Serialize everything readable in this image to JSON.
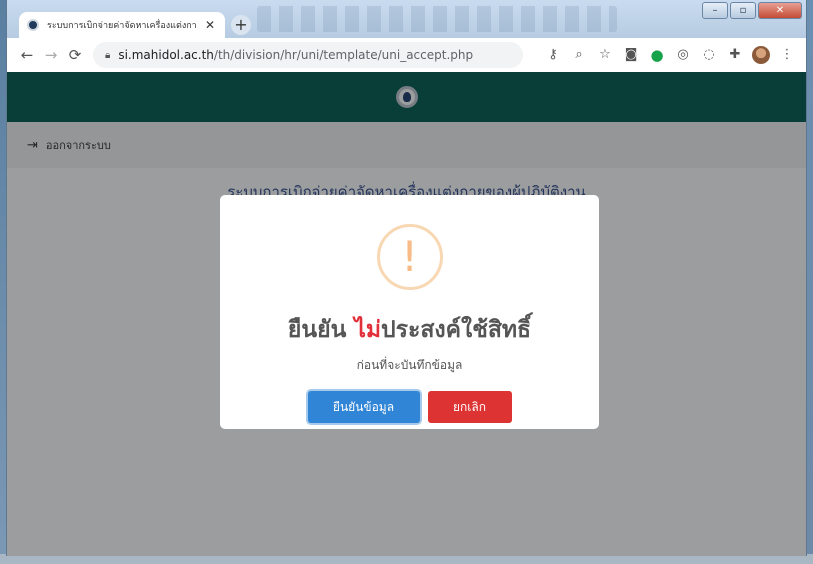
{
  "browser": {
    "tab_title": "ระบบการเบิกจ่ายค่าจัดหาเครื่องแต่งกาย",
    "tab_close": "✕",
    "new_tab": "+",
    "url_host": "si.mahidol.ac.th",
    "url_path": "/th/division/hr/uni/template/uni_accept.php",
    "window_controls": {
      "minimize": "–",
      "maximize": "▫",
      "close": "✕"
    },
    "toolbar_icons": [
      "key-icon",
      "zoom-icon",
      "star-icon",
      "camera-icon",
      "grammarly-icon",
      "extension-icon",
      "extension-icon",
      "puzzle-icon",
      "avatar",
      "menu-icon"
    ]
  },
  "site": {
    "logout_label": "ออกจากระบบ",
    "page_title": "ระบบการเบิกจ่ายค่าจัดหาเครื่องแต่งกายของผู้ปฏิบัติงาน"
  },
  "dialog": {
    "icon": "!",
    "title_prefix": "ยืนยัน ",
    "title_highlight": "ไม่",
    "title_suffix": "ประสงค์ใช้สิทธิ์",
    "text": "ก่อนที่จะบันทึกข้อมูล",
    "confirm_label": "ยืนยันข้อมูล",
    "cancel_label": "ยกเลิก"
  },
  "colors": {
    "header_bg": "#035a4d",
    "confirm_button": "#3085d6",
    "cancel_button": "#dd3333",
    "highlight_text": "#e2303a",
    "warning_icon": "#f8bb86"
  }
}
